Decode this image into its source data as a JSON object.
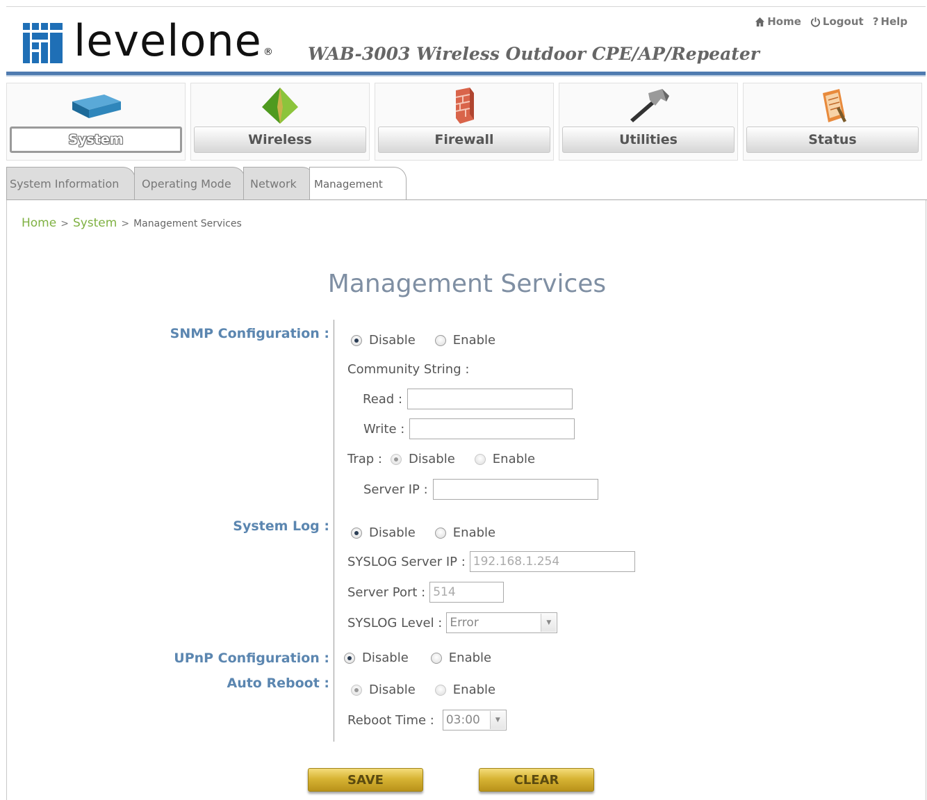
{
  "header": {
    "logo_text_level": "level",
    "logo_text_one": "one",
    "product_title": "WAB-3003 Wireless Outdoor CPE/AP/Repeater",
    "links": {
      "home": "Home",
      "logout": "Logout",
      "help": "Help"
    }
  },
  "nav": {
    "system": "System",
    "wireless": "Wireless",
    "firewall": "Firewall",
    "utilities": "Utilities",
    "status": "Status"
  },
  "subtabs": {
    "system_information": "System Information",
    "operating_mode": "Operating Mode",
    "network": "Network",
    "management": "Management"
  },
  "breadcrumb": {
    "home": "Home",
    "sep": ">",
    "system": "System",
    "current": "Management Services"
  },
  "page_title": "Management Services",
  "snmp": {
    "label": "SNMP Configuration :",
    "disable": "Disable",
    "enable": "Enable",
    "community_string": "Community String :",
    "read_label": "Read :",
    "read_value": "",
    "write_label": "Write :",
    "write_value": "",
    "trap_label": "Trap :",
    "trap_disable": "Disable",
    "trap_enable": "Enable",
    "server_ip_label": "Server IP :",
    "server_ip_value": ""
  },
  "syslog": {
    "label": "System Log :",
    "disable": "Disable",
    "enable": "Enable",
    "server_ip_label": "SYSLOG Server IP :",
    "server_ip_value": "192.168.1.254",
    "server_port_label": "Server Port :",
    "server_port_value": "514",
    "level_label": "SYSLOG Level :",
    "level_value": "Error"
  },
  "upnp": {
    "label": "UPnP Configuration :",
    "disable": "Disable",
    "enable": "Enable"
  },
  "autoreboot": {
    "label": "Auto Reboot :",
    "disable": "Disable",
    "enable": "Enable",
    "time_label": "Reboot Time :",
    "time_value": "03:00"
  },
  "buttons": {
    "save": "SAVE",
    "clear": "CLEAR"
  },
  "colors": {
    "header_rule": "#4f7bb0",
    "logo_blue": "#1f6fb6",
    "breadcrumb_link": "#7fb142",
    "section_label": "#5b86b0",
    "action_button": "#d7b434"
  }
}
